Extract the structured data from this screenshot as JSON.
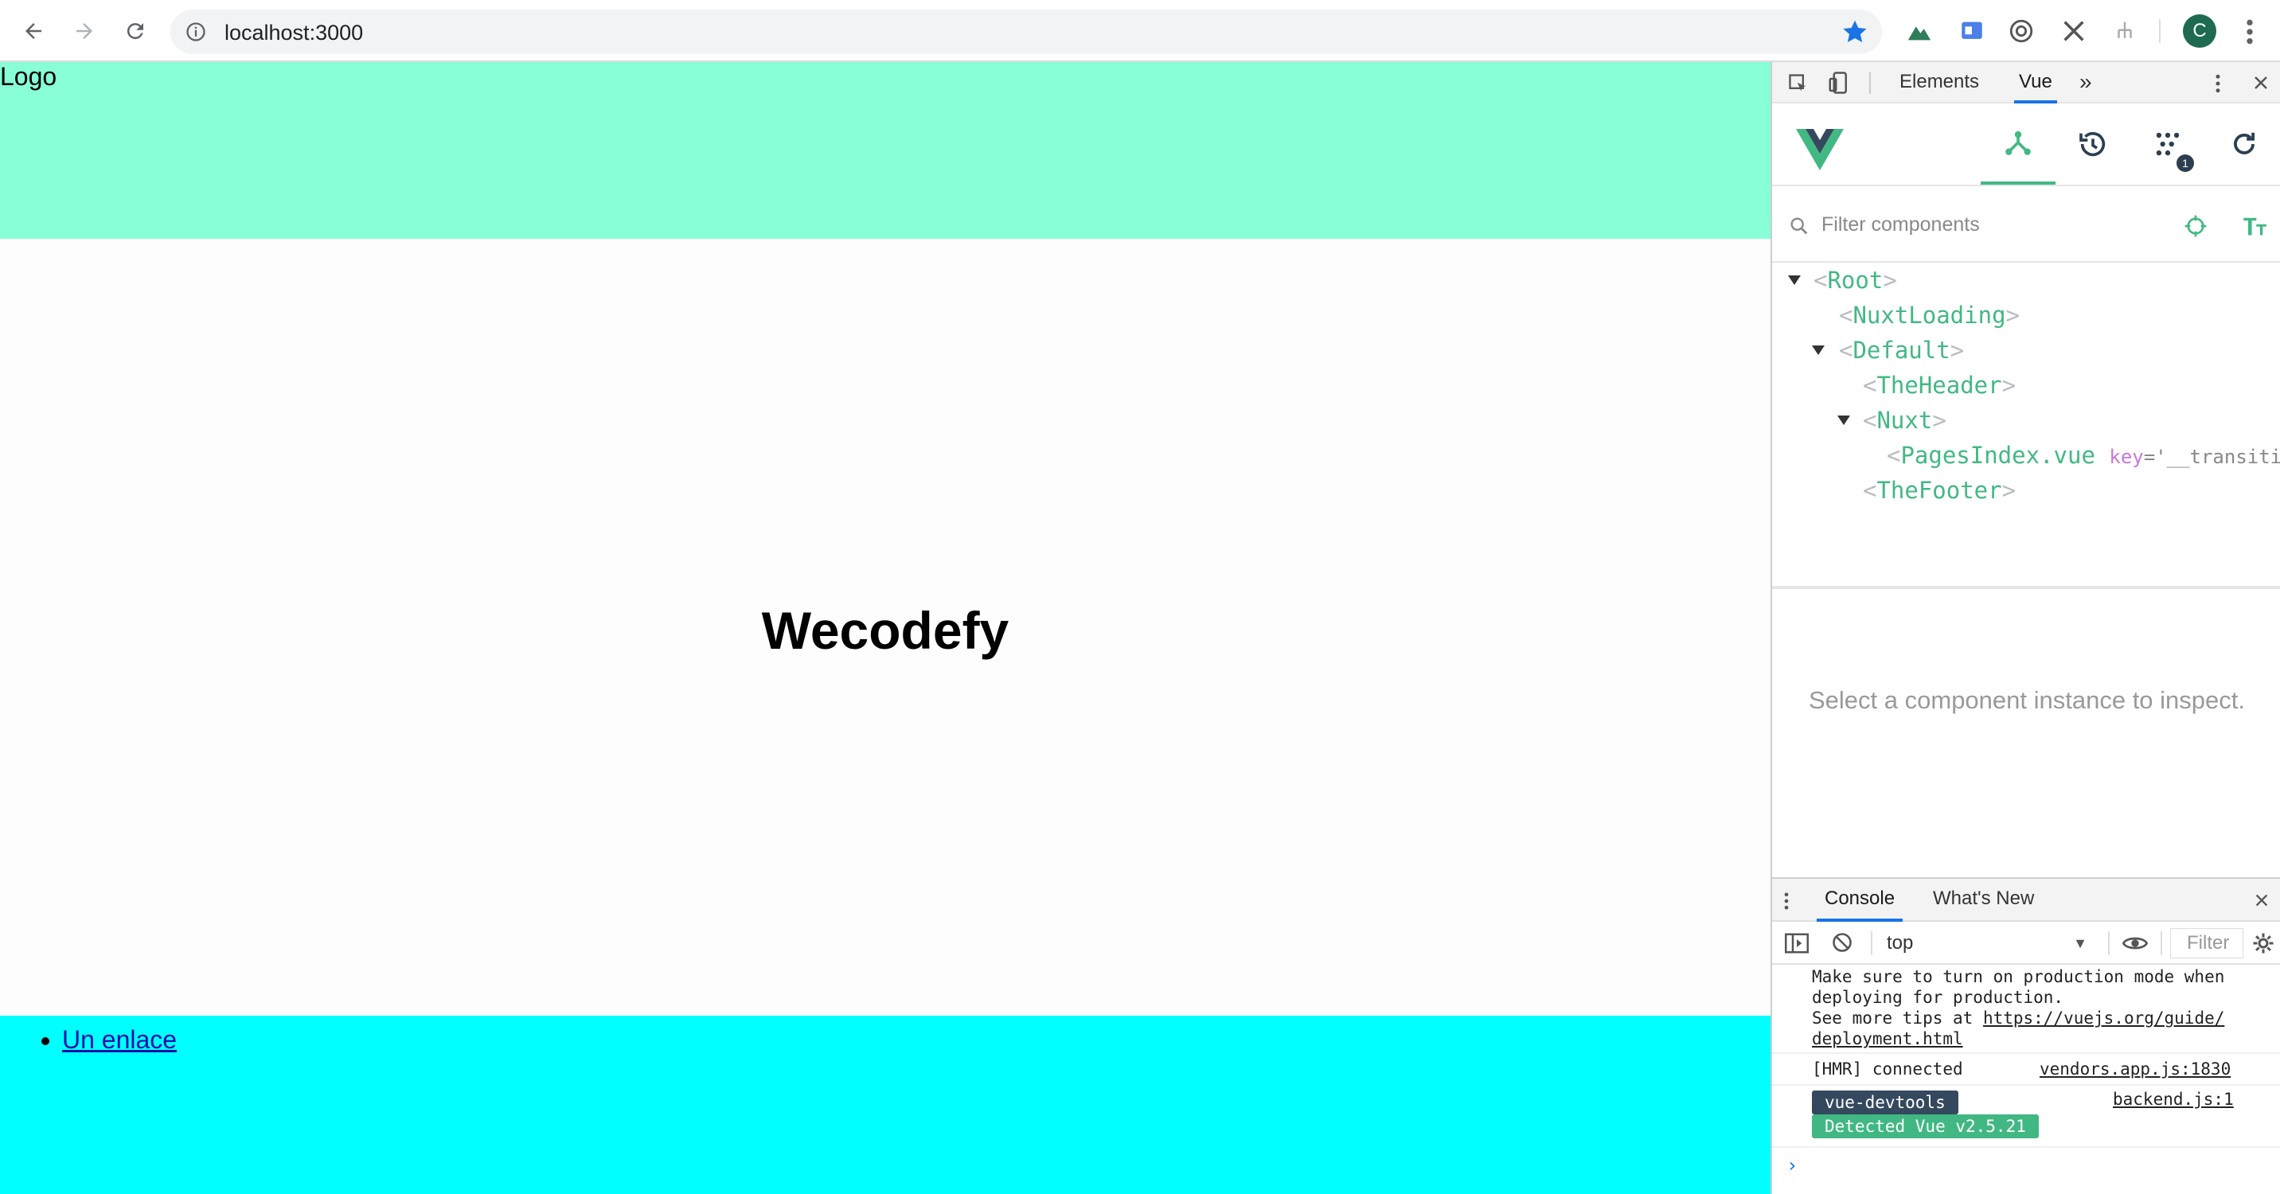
{
  "browser": {
    "url": "localhost:3000",
    "profile_initial": "C",
    "accent_color": "#1a73e8"
  },
  "page": {
    "header": {
      "logo_text": "Logo",
      "bg_color": "#88ffd6"
    },
    "main": {
      "heading": "Wecodefy"
    },
    "footer": {
      "links": [
        "Un enlace"
      ],
      "bg_color": "#00ffff"
    }
  },
  "devtools": {
    "tabs": {
      "elements": "Elements",
      "vue": "Vue",
      "more": "»"
    },
    "vue": {
      "filter_placeholder": "Filter components",
      "events_badge": "1",
      "tree": [
        {
          "name": "Root"
        },
        {
          "name": "NuxtLoading"
        },
        {
          "name": "Default"
        },
        {
          "name": "TheHeader"
        },
        {
          "name": "Nuxt"
        },
        {
          "name": "PagesIndex.vue",
          "attr": "key",
          "attr_value": "='__transiti"
        },
        {
          "name": "TheFooter"
        }
      ],
      "inspect_message": "Select a component instance to inspect.",
      "brand_color": "#42b883"
    },
    "drawer": {
      "tabs": {
        "console": "Console",
        "whats_new": "What's New"
      },
      "context": "top",
      "filter_placeholder": "Filter",
      "messages": {
        "prod_line1": "Make sure to turn on production mode when",
        "prod_line2": "deploying for production.",
        "prod_line3_prefix": "See more tips at ",
        "prod_link1": "https://vuejs.org/guide/",
        "prod_link2": "deployment.html",
        "hmr_text": "[HMR] connected",
        "hmr_source": "vendors.app.js:1830",
        "devtools_tag": "vue-devtools",
        "detected_tag": "Detected Vue v2.5.21",
        "devtools_source": "backend.js:1",
        "prompt": "›"
      }
    }
  }
}
